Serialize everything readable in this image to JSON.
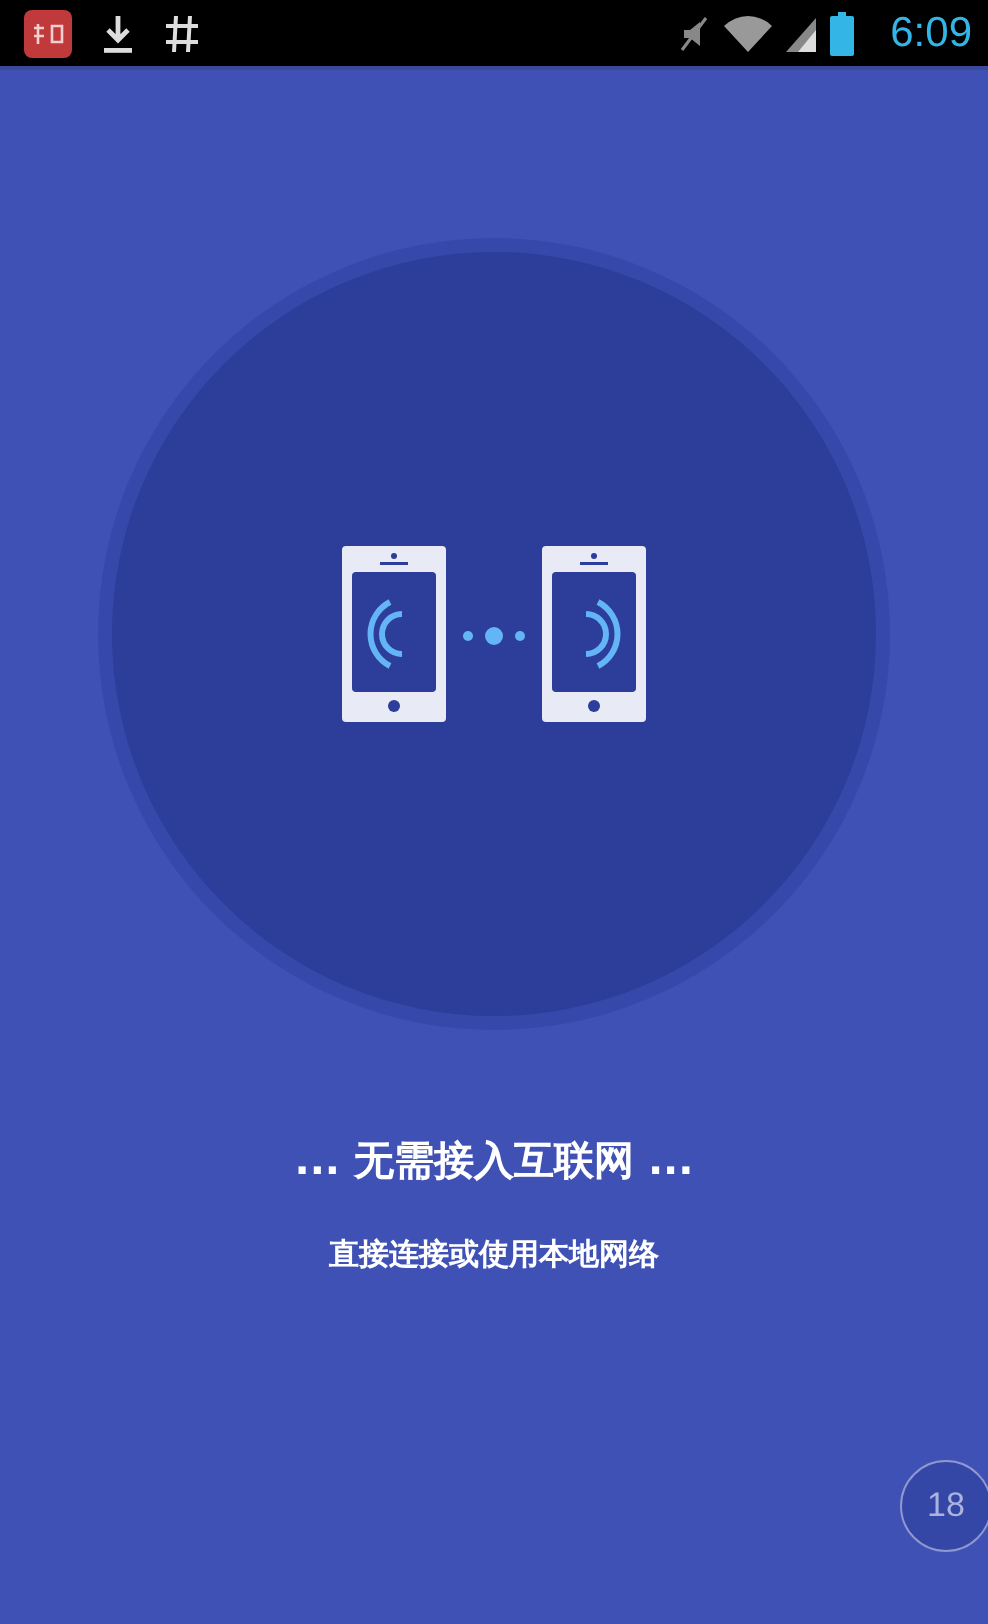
{
  "status_bar": {
    "time": "6:09"
  },
  "headline": "... 无需接入互联网 ...",
  "subtitle": "直接连接或使用本地网络",
  "badge": "18"
}
